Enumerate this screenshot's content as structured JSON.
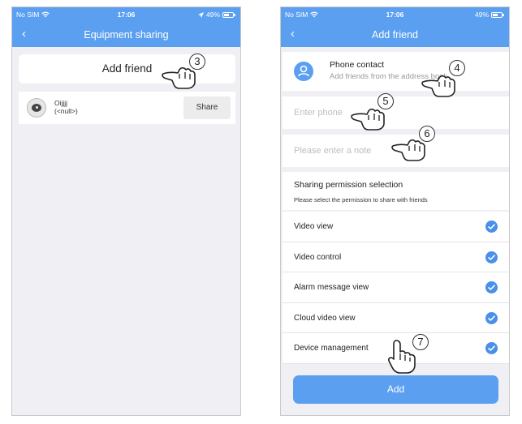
{
  "status_bar": {
    "carrier": "No SIM",
    "time": "17:06",
    "battery": "49%"
  },
  "screen1": {
    "nav": {
      "back_icon": "chevron-left-icon",
      "title": "Equipment sharing"
    },
    "add_friend_label": "Add friend",
    "device": {
      "name": "Oijjjj",
      "subtitle": "(<null>)",
      "share_label": "Share"
    },
    "step_marker": "3"
  },
  "screen2": {
    "nav": {
      "back_icon": "chevron-left-icon",
      "title": "Add friend"
    },
    "contact": {
      "icon": "person-icon",
      "title": "Phone contact",
      "subtitle": "Add friends from the address book"
    },
    "phone_input": {
      "placeholder": "Enter phone",
      "value": ""
    },
    "note_input": {
      "placeholder": "Please enter a note",
      "value": ""
    },
    "permissions": {
      "title": "Sharing permission selection",
      "subtitle": "Please select the permission to share with friends",
      "items": [
        {
          "label": "Video view",
          "checked": true
        },
        {
          "label": "Video control",
          "checked": true
        },
        {
          "label": "Alarm message view",
          "checked": true
        },
        {
          "label": "Cloud video view",
          "checked": true
        },
        {
          "label": "Device management",
          "checked": true
        }
      ]
    },
    "add_button_label": "Add",
    "step_markers": [
      "4",
      "5",
      "6",
      "7"
    ]
  },
  "colors": {
    "header": "#5a9ff0",
    "checkbox": "#4a90e8",
    "background": "#efeff4"
  }
}
